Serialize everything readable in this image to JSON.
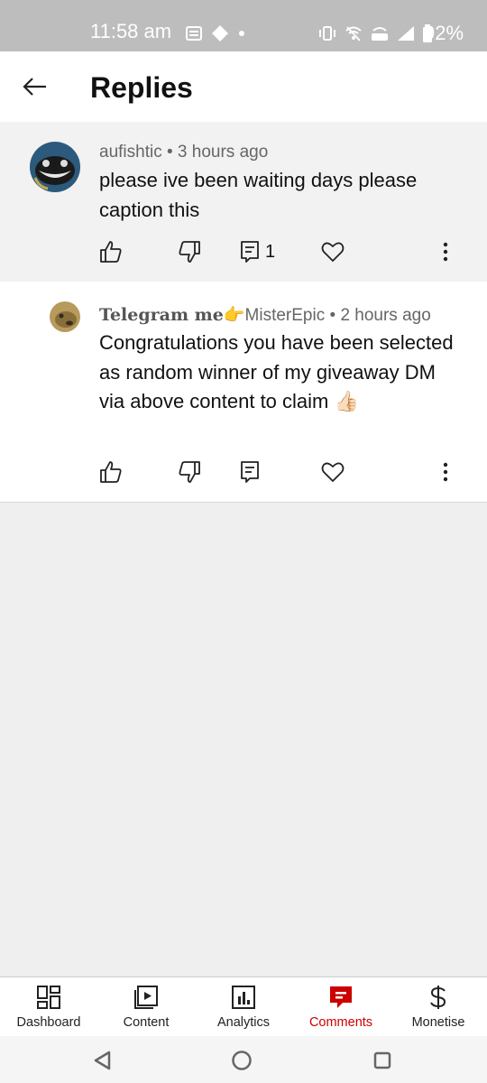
{
  "status_bar": {
    "time": "11:58 am",
    "battery": "92%"
  },
  "header": {
    "title": "Replies"
  },
  "comments": [
    {
      "author": "aufishtic",
      "time_ago": "3 hours ago",
      "text": "please ive been waiting days please caption this",
      "reply_count": "1"
    },
    {
      "author_prefix": "Telegram me👉",
      "author": "MisterEpic",
      "time_ago": "2 hours ago",
      "text": "Congratulations you have been selected as random winner of my giveaway DM via  above content to claim 👍🏻"
    }
  ],
  "separator": " • ",
  "bottom_nav": [
    {
      "label": "Dashboard",
      "icon": "dashboard-icon"
    },
    {
      "label": "Content",
      "icon": "content-icon"
    },
    {
      "label": "Analytics",
      "icon": "analytics-icon"
    },
    {
      "label": "Comments",
      "icon": "comments-icon",
      "active": true
    },
    {
      "label": "Monetise",
      "icon": "dollar-icon"
    }
  ],
  "colors": {
    "accent": "#cc0000",
    "status_bar": "#bdbdbd",
    "background": "#efefef"
  }
}
